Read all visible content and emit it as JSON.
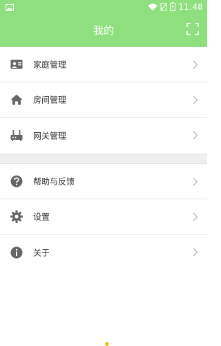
{
  "status_bar": {
    "time": "11:48",
    "icons": [
      "image-icon",
      "wifi-icon",
      "no-sim-icon",
      "battery-charging-icon"
    ]
  },
  "header": {
    "title": "我的",
    "right_icon": "scan-icon"
  },
  "menu_group_1": [
    {
      "label": "家庭管理",
      "icon": "family-card-icon"
    },
    {
      "label": "房间管理",
      "icon": "home-icon"
    },
    {
      "label": "网关管理",
      "icon": "router-icon"
    }
  ],
  "menu_group_2": [
    {
      "label": "帮助与反馈",
      "icon": "help-icon"
    },
    {
      "label": "设置",
      "icon": "gear-icon"
    },
    {
      "label": "关于",
      "icon": "info-icon"
    }
  ],
  "colors": {
    "accent": "#8ee07e",
    "icon": "#666666",
    "chevron": "#bbbbbb"
  }
}
